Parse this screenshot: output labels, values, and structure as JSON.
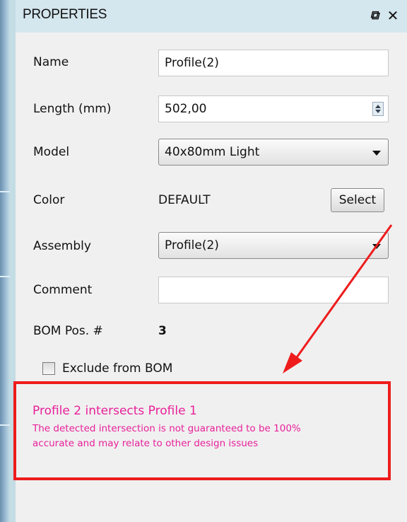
{
  "panel": {
    "title": "PROPERTIES",
    "float_icon": "ɵ",
    "close_icon": "✕"
  },
  "fields": {
    "name_label": "Name",
    "name_value": "Profile(2)",
    "length_label": "Length  (mm)",
    "length_value": "502,00",
    "model_label": "Model",
    "model_value": "40x80mm Light",
    "color_label": "Color",
    "color_value": "DEFAULT",
    "color_button": "Select",
    "assembly_label": "Assembly",
    "assembly_value": "Profile(2)",
    "comment_label": "Comment",
    "comment_value": "",
    "bom_label": "BOM Pos. #",
    "bom_value": "3",
    "exclude_label": "Exclude from BOM"
  },
  "warning": {
    "title": "Profile 2 intersects Profile 1",
    "line1": "The detected intersection is not guaranteed to be 100%",
    "line2": "accurate and may relate to other design issues"
  },
  "colors": {
    "warning_text": "#e8209a",
    "annotation_red": "#ee1c1c"
  }
}
